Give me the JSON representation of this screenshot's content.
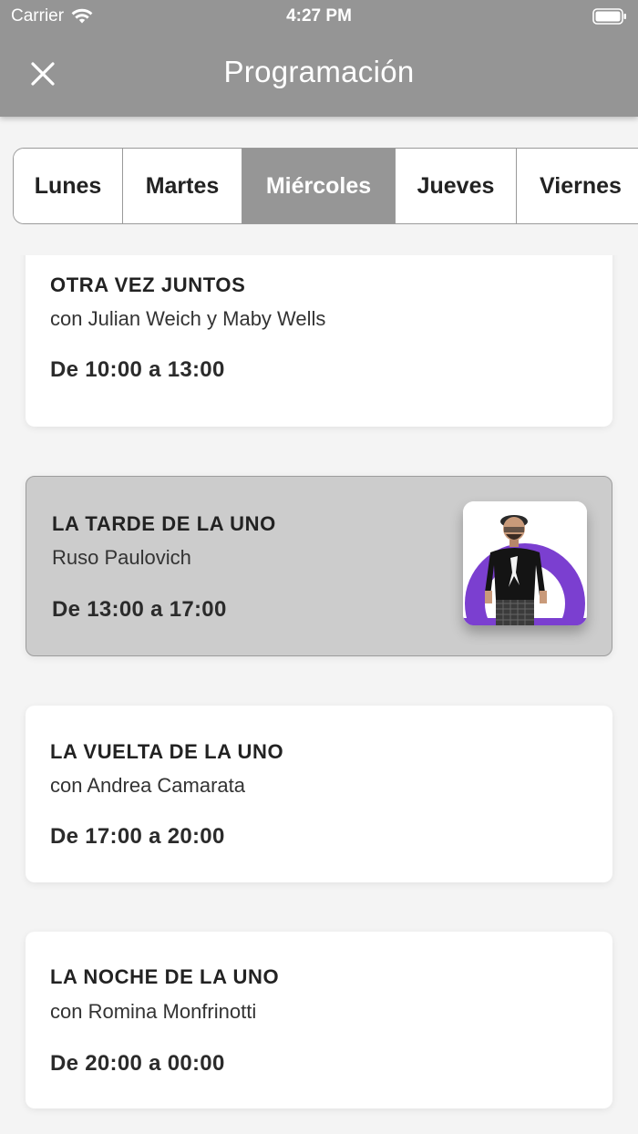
{
  "status_bar": {
    "carrier": "Carrier",
    "time": "4:27 PM",
    "icons": [
      "wifi-icon",
      "battery-icon"
    ]
  },
  "header": {
    "title": "Programación",
    "close_icon": "close-icon"
  },
  "tabs": [
    {
      "label": "Lunes",
      "active": false
    },
    {
      "label": "Martes",
      "active": false
    },
    {
      "label": "Miércoles",
      "active": true
    },
    {
      "label": "Jueves",
      "active": false
    },
    {
      "label": "Viernes",
      "active": false
    }
  ],
  "programs": [
    {
      "title": "OTRA VEZ JUNTOS",
      "host": "con Julian Weich y Maby Wells",
      "hours": "De 10:00 a 13:00",
      "active": false
    },
    {
      "title": "LA TARDE DE LA UNO",
      "host": "Ruso Paulovich",
      "hours": "De 13:00 a 17:00",
      "active": true,
      "photo": "host-photo"
    },
    {
      "title": "LA VUELTA DE LA UNO",
      "host": "con Andrea Camarata",
      "hours": "De 17:00 a 20:00",
      "active": false
    },
    {
      "title": "LA NOCHE DE LA UNO",
      "host": "con Romina Monfrinotti",
      "hours": "De 20:00 a 00:00",
      "active": false
    }
  ],
  "colors": {
    "header_bg": "#959595",
    "active_tab_bg": "#969696",
    "active_card_bg": "#cccccc",
    "photo_accent": "#7b3fd0"
  }
}
